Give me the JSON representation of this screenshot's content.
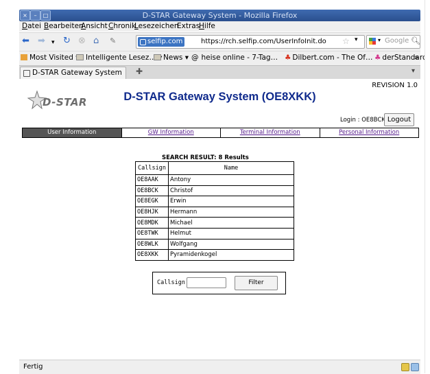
{
  "window": {
    "title": "D-STAR Gateway System - Mozilla Firefox",
    "buttons": [
      "close",
      "minimize",
      "maximize"
    ]
  },
  "menu": [
    "Datei",
    "Bearbeiten",
    "Ansicht",
    "Chronik",
    "Lesezeichen",
    "Extras",
    "Hilfe"
  ],
  "menu_access_keys": [
    "D",
    "B",
    "A",
    "C",
    "L",
    "x",
    "H"
  ],
  "navigation": {
    "url_badge": "selfip.com",
    "url": "https://rch.selfip.com/UserInfoInit.do",
    "search_placeholder": "Google"
  },
  "bookmarks": [
    {
      "label": "Most Visited",
      "icon": "folder-icon",
      "dropdown": true
    },
    {
      "label": "Intelligente Lesez…",
      "icon": "folder-icon",
      "dropdown": true
    },
    {
      "label": "News",
      "icon": "folder-icon",
      "dropdown": true
    },
    {
      "label": "heise online - 7-Tag…",
      "icon": "rss-icon",
      "dropdown": false
    },
    {
      "label": "Dilbert.com - The Of…",
      "icon": "dilbert-icon",
      "dropdown": false
    },
    {
      "label": "derStandard.at",
      "icon": "standard-icon",
      "dropdown": false
    }
  ],
  "tab": {
    "label": "D-STAR Gateway System"
  },
  "page": {
    "logo_text": "D-STAR",
    "revision": "REVISION 1.0",
    "heading": "D-STAR Gateway System (OE8XKK)",
    "login_label": "Login : OE8BCK",
    "logout_label": "Logout",
    "nav_tabs": [
      {
        "label": "User Information",
        "active": true
      },
      {
        "label": "GW Information",
        "active": false
      },
      {
        "label": "Terminal Information",
        "active": false
      },
      {
        "label": "Personal Information",
        "active": false
      }
    ],
    "search_result_title": "SEARCH RESULT:  8  Results",
    "table": {
      "columns": [
        "Callsign",
        "Name"
      ],
      "rows": [
        [
          "OE8AAK",
          "Antony"
        ],
        [
          "OE8BCK",
          "Christof"
        ],
        [
          "OE8EGK",
          "Erwin"
        ],
        [
          "OE8HJK",
          "Hermann"
        ],
        [
          "OE8MDK",
          "Michael"
        ],
        [
          "OE8TWK",
          "Helmut"
        ],
        [
          "OE8WLK",
          "Wolfgang"
        ],
        [
          "OE8XKK",
          "Pyramidenkogel"
        ]
      ]
    },
    "filter": {
      "label": "Callsign",
      "value": "",
      "button": "Filter"
    }
  },
  "status": {
    "text": "Fertig"
  },
  "colors": {
    "titlebar": "#2f5a9e",
    "heading": "#0f2a8c",
    "active_tab": "#555555",
    "link": "#551a8b"
  }
}
